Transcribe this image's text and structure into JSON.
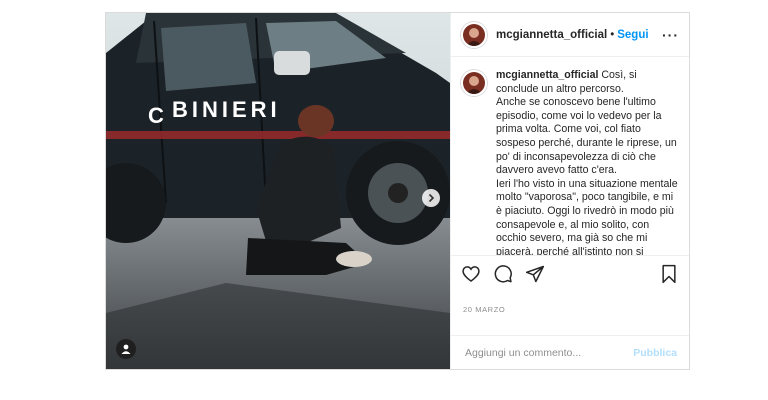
{
  "post": {
    "username": "mcgiannetta_official",
    "separator": "•",
    "follow_label": "Segui",
    "more_icon": "more-horizontal-icon",
    "photo": {
      "vehicle_lettering": "CABINIERI",
      "alt": ""
    },
    "caption": {
      "username": "mcgiannetta_official",
      "text": "Così, si conclude un altro percorso.\nAnche se conoscevo bene l'ultimo episodio, come voi lo vedevo per la prima volta. Come voi, col fiato sospeso perché, durante le riprese, un po' di inconsapevolezza di ciò che davvero avevo fatto c'era.\nIeri l'ho visto in una situazione mentale molto \"vaporosa\", poco tangibile, e mi è piaciuto. Oggi lo rivedrò in modo più consapevole e, al mio solito, con occhio severo, ma già so che mi piacerà, perché all'istinto non si comanda.\nHo finalmente visto tutto il percorso di Anna, che sbaglia, che non riesce ad ascoltarsi, che lotta contro una parte ben radicata in lei che la costringe ad andare verso ciò che è sicuro, che è"
    },
    "date": "20 MARZO",
    "comment_placeholder": "Aggiungi un commento...",
    "publish_label": "Pubblica",
    "colors": {
      "link": "#0095f6",
      "publish_disabled": "#b2dffc",
      "muted": "#8e8e8e"
    }
  }
}
